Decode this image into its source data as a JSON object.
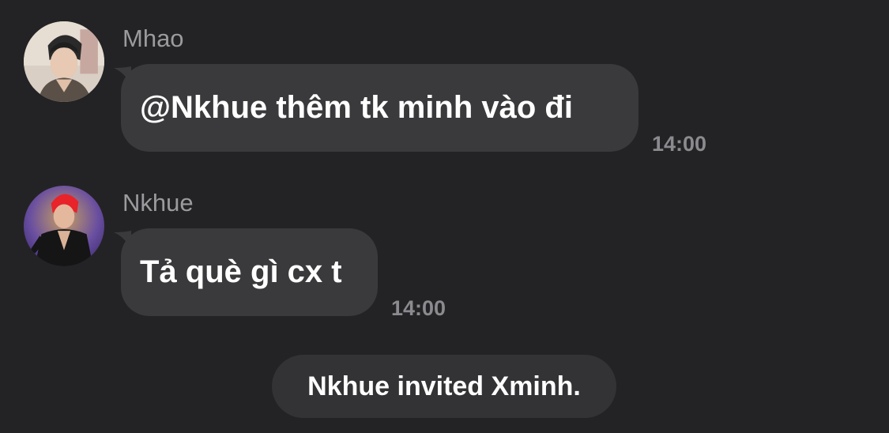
{
  "messages": [
    {
      "sender": "Mhao",
      "text": "@Nkhue thêm tk minh vào đi",
      "time": "14:00",
      "avatar": "user-photo-mhao"
    },
    {
      "sender": "Nkhue",
      "text": "Tả què gì cx t",
      "time": "14:00",
      "avatar": "user-photo-nkhue"
    }
  ],
  "system_message": "Nkhue invited Xminh.",
  "colors": {
    "background": "#232325",
    "bubble": "#3a3a3c",
    "sender_name": "#9a9a9f",
    "timestamp": "#8a8a8f",
    "system_pill": "#333335"
  }
}
